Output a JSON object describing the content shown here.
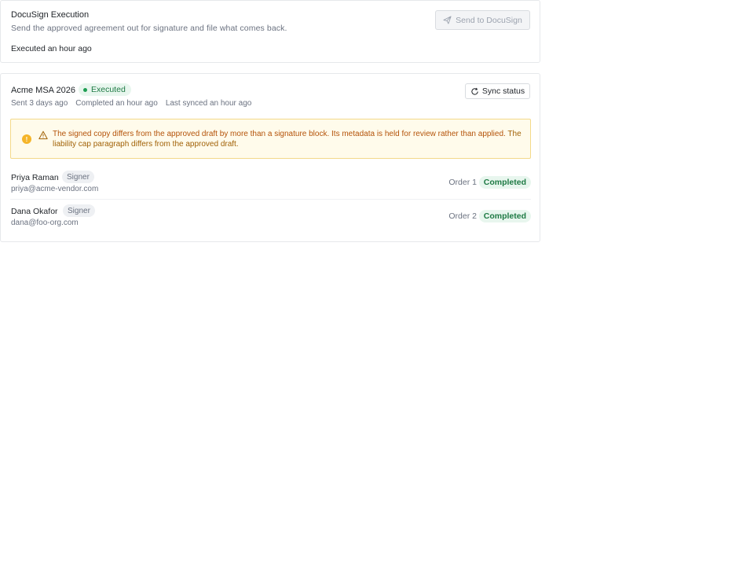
{
  "execution": {
    "title": "DocuSign Execution",
    "description": "Send the approved agreement out for signature and file what comes back.",
    "status_text": "Executed an hour ago",
    "send_button_label": "Send to DocuSign",
    "send_button_icon": "send-icon"
  },
  "envelope": {
    "title": "Acme MSA 2026",
    "status_badge": "Executed",
    "meta": [
      "Sent 3 days ago",
      "Completed an hour ago",
      "Last synced an hour ago"
    ],
    "sync_button_label": "Sync status",
    "sync_button_icon": "refresh-icon",
    "alert": {
      "text": "The signed copy differs from the approved draft by more than a signature block. Its metadata is held for review rather than applied.",
      "detail": "The liability cap paragraph differs from the approved draft.",
      "icon": "warning-icon"
    },
    "signers": [
      {
        "name": "Priya Raman",
        "role": "Signer",
        "email": "priya@acme-vendor.com",
        "order": "Order 1",
        "status": "Completed"
      },
      {
        "name": "Dana Okafor",
        "role": "Signer",
        "email": "dana@foo-org.com",
        "order": "Order 2",
        "status": "Completed"
      }
    ]
  },
  "colors": {
    "success_bg": "#e8f6ee",
    "success_text": "#1e7a44",
    "warning_bg": "#fffbeb",
    "warning_border": "#f4d98a",
    "warning_text": "#a16207"
  }
}
